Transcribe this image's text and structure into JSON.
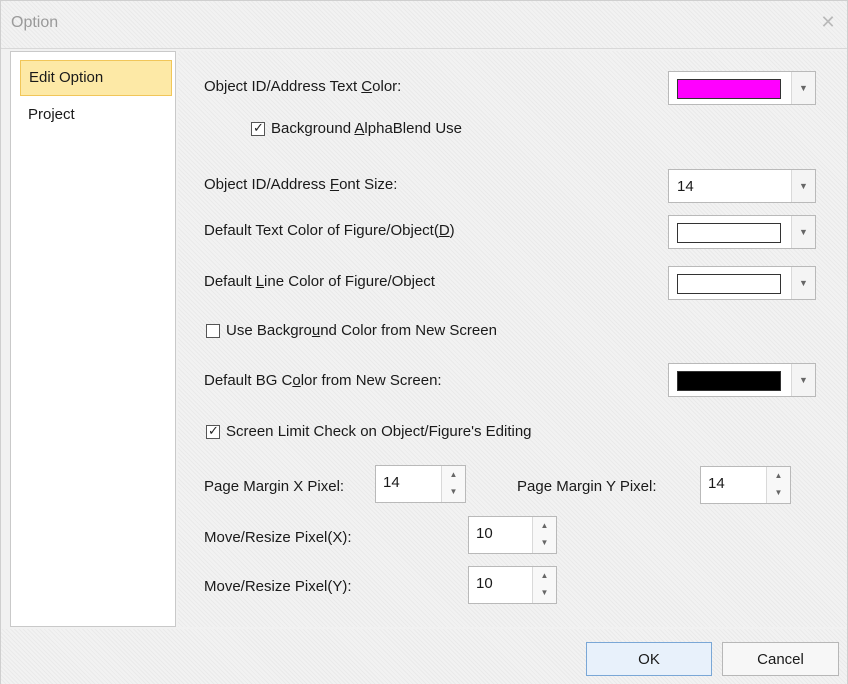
{
  "window": {
    "title": "Option",
    "close_glyph": "✕"
  },
  "sidebar": {
    "items": [
      {
        "label": "Edit Option",
        "selected": true
      },
      {
        "label": "Project",
        "selected": false
      }
    ]
  },
  "options": {
    "id_text_color": {
      "label_pre": "Object ID/Address Text ",
      "label_u": "C",
      "label_post": "olor:",
      "color": "#ff00ff"
    },
    "bg_alphablend": {
      "label_pre": "Background ",
      "label_u": "A",
      "label_post": "lphaBlend Use",
      "checked": true
    },
    "id_font_size": {
      "label_pre": "Object ID/Address ",
      "label_u": "F",
      "label_post": "ont Size:",
      "value": "14"
    },
    "default_text_color": {
      "label_pre": "Default Text Color of Figure/Object(",
      "label_u": "D",
      "label_post": ")",
      "color": "#ffffff"
    },
    "default_line_color": {
      "label_pre": "Default ",
      "label_u": "L",
      "label_post": "ine Color of Figure/Object",
      "color": "#ffffff"
    },
    "use_bg_color": {
      "label_pre": "Use Backgro",
      "label_u": "u",
      "label_post": "nd Color from New Screen",
      "checked": false
    },
    "default_bg_color": {
      "label_pre": "Default BG C",
      "label_u": "o",
      "label_post": "lor from New Screen:",
      "color": "#000000"
    },
    "screen_limit_check": {
      "label": "Screen Limit Check on Object/Figure's Editing",
      "checked": true
    },
    "page_margin_x": {
      "label": "Page Margin X Pixel:",
      "value": "14"
    },
    "page_margin_y": {
      "label": "Page Margin Y Pixel:",
      "value": "14"
    },
    "move_resize_x": {
      "label": "Move/Resize Pixel(X):",
      "value": "10"
    },
    "move_resize_y": {
      "label": "Move/Resize Pixel(Y):",
      "value": "10"
    }
  },
  "footer": {
    "ok_label": "OK",
    "cancel_label": "Cancel"
  },
  "glyphs": {
    "dropdown": "▼",
    "spin_up": "▲",
    "spin_down": "▼",
    "check": "✓"
  },
  "colors": {
    "selection_bg": "#fde9a6",
    "selection_border": "#f1c659",
    "ok_border": "#7aa7d6"
  }
}
